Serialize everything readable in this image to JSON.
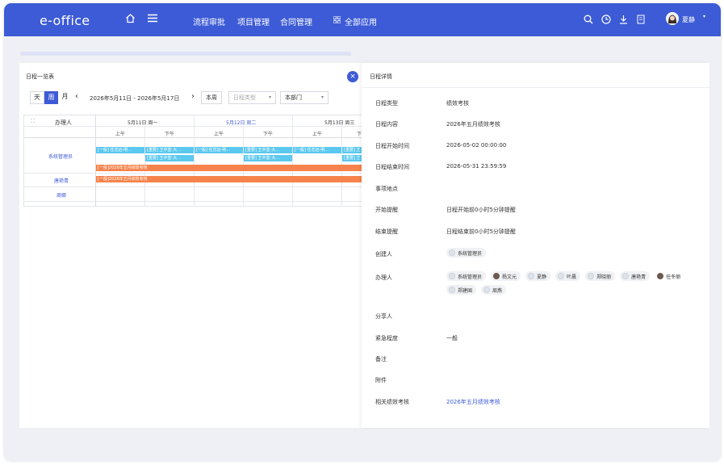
{
  "header": {
    "logo": "e-office",
    "nav": [
      "流程审批",
      "项目管理",
      "合同管理",
      "全部应用"
    ],
    "user": "夏静"
  },
  "schedule": {
    "title": "日程一览表",
    "views": [
      "天",
      "周",
      "月"
    ],
    "range": "2026年5月11日 - 2026年5月17日",
    "this_week": "本周",
    "type_placeholder": "日程类型",
    "dept": "本部门",
    "owner_header": "办理人",
    "days": [
      "5月11日 周一",
      "5月12日 周二",
      "5月13日 周三"
    ],
    "am": "上午",
    "pm": "下午",
    "owners": [
      "系统管理员",
      "唐艳青",
      "周娜"
    ],
    "events_row1": [
      "[一般] 任志远-明...",
      "[重要] 王中奎-大...",
      "[一般] 任志远-明...",
      "[重要] 王中奎-大...",
      "[一般] 任志远-明...",
      "[重要] 王"
    ],
    "events_row2": [
      "[重要] 王中奎-大...",
      "[重要] 王中奎-大...",
      "[重要] 王"
    ],
    "wide_event": "[一般]2026年五月绩效考核"
  },
  "detail": {
    "title": "日程详情",
    "fields": {
      "type_label": "日程类型",
      "type": "绩效考核",
      "content_label": "日程内容",
      "content": "2026年五月绩效考核",
      "start_label": "日程开始时间",
      "start": "2026-05-02 00:00:00",
      "end_label": "日程结束时间",
      "end": "2026-05-31 23:59:59",
      "location_label": "事项地点",
      "start_remind_label": "开始提醒",
      "start_remind": "日程开始前0小时5分钟提醒",
      "end_remind_label": "结束提醒",
      "end_remind": "日程结束前0小时5分钟提醒",
      "creator_label": "创建人",
      "creator": "系统管理员",
      "handlers_label": "办理人",
      "handlers": [
        "系统管理员",
        "杨文元",
        "夏静",
        "叶晨",
        "郑晓丽",
        "唐艳青",
        "任冬丽",
        "郑建国",
        "周燕"
      ],
      "sharer_label": "分享人",
      "urgency_label": "紧急程度",
      "urgency": "一般",
      "note_label": "备注",
      "attach_label": "附件",
      "related_label": "相关绩效考核",
      "related": "2026年五月绩效考核"
    }
  },
  "colors": {
    "brand": "#3d5bd6",
    "event_blue": "#5bc8f0",
    "event_orange": "#f6834b",
    "link": "#3d5bd6"
  }
}
